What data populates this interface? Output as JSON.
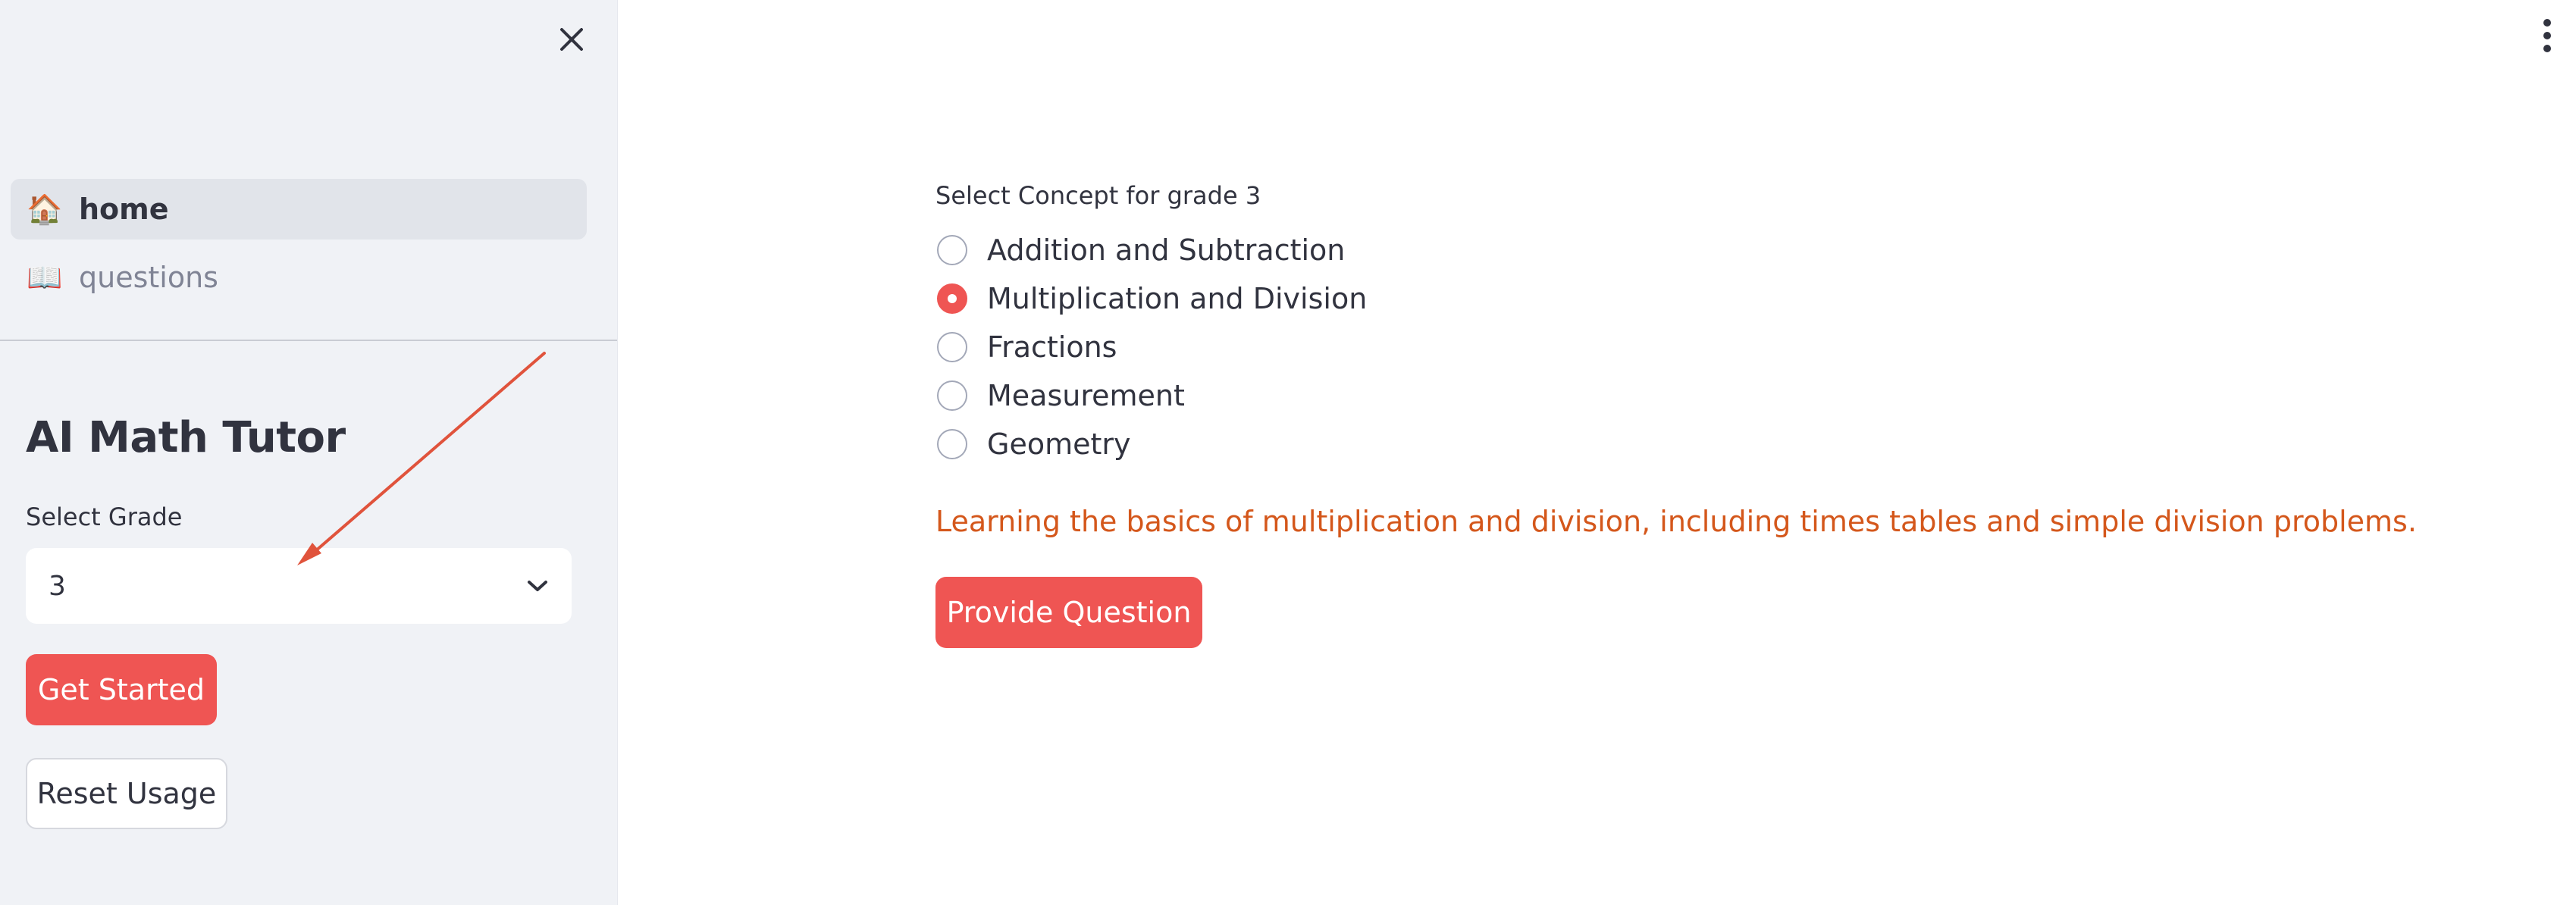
{
  "sidebar": {
    "nav": [
      {
        "icon": "house-icon",
        "emoji": "🏠",
        "label": "home",
        "active": true
      },
      {
        "icon": "open-book-icon",
        "emoji": "📖",
        "label": "questions",
        "active": false
      }
    ],
    "app_title": "AI Math Tutor",
    "grade_select": {
      "label": "Select Grade",
      "value": "3"
    },
    "get_started_label": "Get Started",
    "reset_usage_label": "Reset Usage"
  },
  "main": {
    "concept_label": "Select Concept for grade 3",
    "concepts": [
      {
        "label": "Addition and Subtraction",
        "selected": false
      },
      {
        "label": "Multiplication and Division",
        "selected": true
      },
      {
        "label": "Fractions",
        "selected": false
      },
      {
        "label": "Measurement",
        "selected": false
      },
      {
        "label": "Geometry",
        "selected": false
      }
    ],
    "description": "Learning the basics of multiplication and division, including times tables and simple division problems.",
    "provide_question_label": "Provide Question"
  },
  "colors": {
    "primary": "#ef5553",
    "sidebar_bg": "#f0f2f6",
    "description_text": "#d4571b",
    "annotation_arrow": "#e0533c"
  }
}
